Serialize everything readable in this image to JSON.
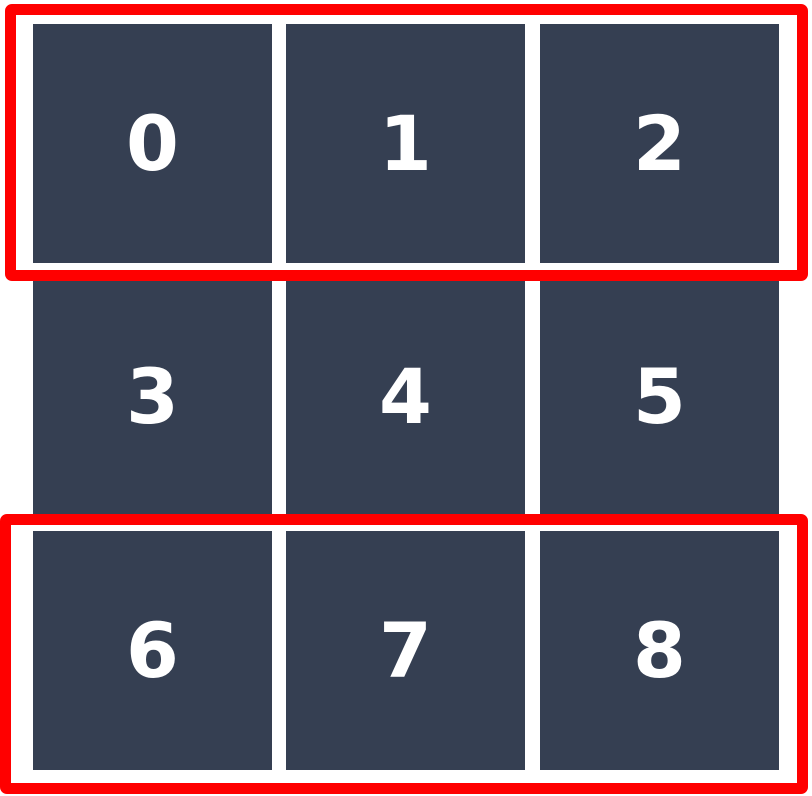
{
  "cells": [
    "0",
    "1",
    "2",
    "3",
    "4",
    "5",
    "6",
    "7",
    "8"
  ],
  "colors": {
    "cell_fill": "#353f52",
    "cell_text": "#ffffff",
    "highlight": "#ff0000",
    "background": "#ffffff"
  },
  "highlighted_rows": [
    0,
    2
  ]
}
